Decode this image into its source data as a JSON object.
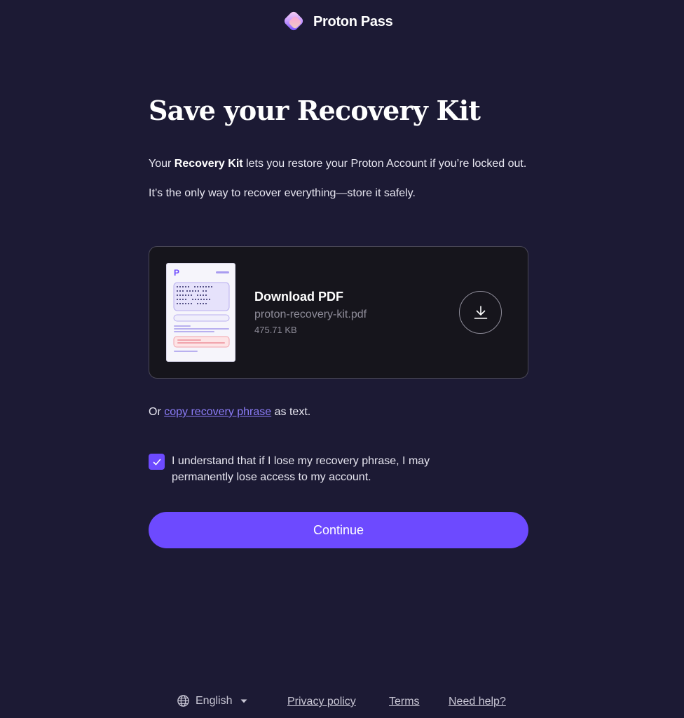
{
  "brand": {
    "name": "Proton Pass",
    "accent": "#6d4aff",
    "background": "#1c1a34"
  },
  "main": {
    "title": "Save your Recovery Kit",
    "intro_prefix": "Your ",
    "intro_bold": "Recovery Kit",
    "intro_suffix": " lets you restore your Proton Account if you’re locked out.",
    "note": "It’s the only way to recover everything—store it safely."
  },
  "download_card": {
    "title": "Download PDF",
    "filename": "proton-recovery-kit.pdf",
    "filesize": "475.71 KB",
    "button_icon": "download-icon"
  },
  "copy_line": {
    "prefix": "Or ",
    "link": "copy recovery phrase",
    "suffix": " as text."
  },
  "acknowledge": {
    "checked": true,
    "text": "I understand that if I lose my recovery phrase, I may permanently lose access to my account."
  },
  "continue_label": "Continue",
  "footer": {
    "language": "English",
    "language_icon": "globe-icon",
    "privacy": "Privacy policy",
    "terms": "Terms",
    "help": "Need help?"
  }
}
